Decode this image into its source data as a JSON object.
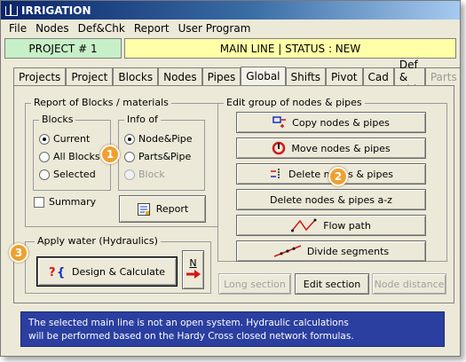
{
  "window": {
    "title": "IRRIGATION"
  },
  "menu": [
    "File",
    "Nodes",
    "Def&Chk",
    "Report",
    "User Program"
  ],
  "project": {
    "label": "PROJECT # 1"
  },
  "status": {
    "text": "MAIN LINE  |  STATUS : NEW"
  },
  "tabs": [
    {
      "label": "Projects",
      "state": "normal"
    },
    {
      "label": "Project",
      "state": "normal"
    },
    {
      "label": "Blocks",
      "state": "normal"
    },
    {
      "label": "Nodes",
      "state": "normal"
    },
    {
      "label": "Pipes",
      "state": "normal"
    },
    {
      "label": "Global",
      "state": "active"
    },
    {
      "label": "Shifts",
      "state": "normal"
    },
    {
      "label": "Pivot",
      "state": "normal"
    },
    {
      "label": "Cad",
      "state": "normal"
    },
    {
      "label": "Def & Chk",
      "state": "normal"
    },
    {
      "label": "Parts",
      "state": "disabled"
    }
  ],
  "report": {
    "title": "Report of Blocks / materials",
    "blocks": {
      "title": "Blocks",
      "options": [
        "Current",
        "All Blocks",
        "Selected"
      ],
      "selected": "Current"
    },
    "info": {
      "title": "Info of",
      "options": [
        "Node&Pipe",
        "Parts&Pipe",
        "Block"
      ],
      "selected": "Node&Pipe",
      "disabled": [
        "Block"
      ]
    },
    "summary_label": "Summary",
    "summary_checked": false,
    "report_button": "Report"
  },
  "water": {
    "title": "Apply water (Hydraulics)",
    "design_button": "Design & Calculate",
    "n_button": "N"
  },
  "edit": {
    "title": "Edit group of nodes & pipes",
    "buttons": {
      "copy": "Copy nodes & pipes",
      "move": "Move nodes & pipes",
      "delete": "Delete nodes & pipes",
      "delete_az": "Delete nodes & pipes a-z",
      "flow": "Flow path",
      "divide": "Divide segments"
    }
  },
  "section_buttons": {
    "long": "Long section",
    "edit": "Edit section",
    "node_distance": "Node distance"
  },
  "badges": [
    "1",
    "2",
    "3"
  ],
  "info_message": {
    "line1": "The selected main line is not an open system. Hydraulic calculations",
    "line2": "will be performed based on the Hardy Cross closed network formulas."
  },
  "colors": {
    "project_bg": "#c8f0c8",
    "status_bg": "#ffffa8",
    "badge": "#f0a030",
    "info_bg": "#2b3fa0"
  }
}
